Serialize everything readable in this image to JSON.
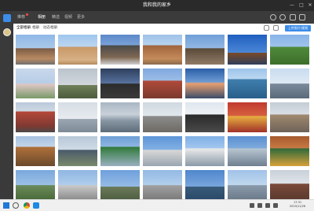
{
  "window": {
    "title": "我和我的家乡"
  },
  "nav": {
    "items": [
      {
        "label": "推荐"
      },
      {
        "label": "相册"
      },
      {
        "label": "精选"
      },
      {
        "label": "视频"
      },
      {
        "label": "更多"
      }
    ]
  },
  "subnav": {
    "items": [
      {
        "label": "全部相册"
      },
      {
        "label": "相册"
      },
      {
        "label": "动态相册"
      }
    ],
    "upload_label": "上传照片/视频"
  },
  "clock": {
    "time": "17:31",
    "date": "2020/11/26"
  },
  "colors": {
    "accent": "#3c8ce8",
    "titlebar": "#2a2a2a",
    "sidebar": "#3a3a3a"
  },
  "photos": {
    "count_visible": 35
  }
}
